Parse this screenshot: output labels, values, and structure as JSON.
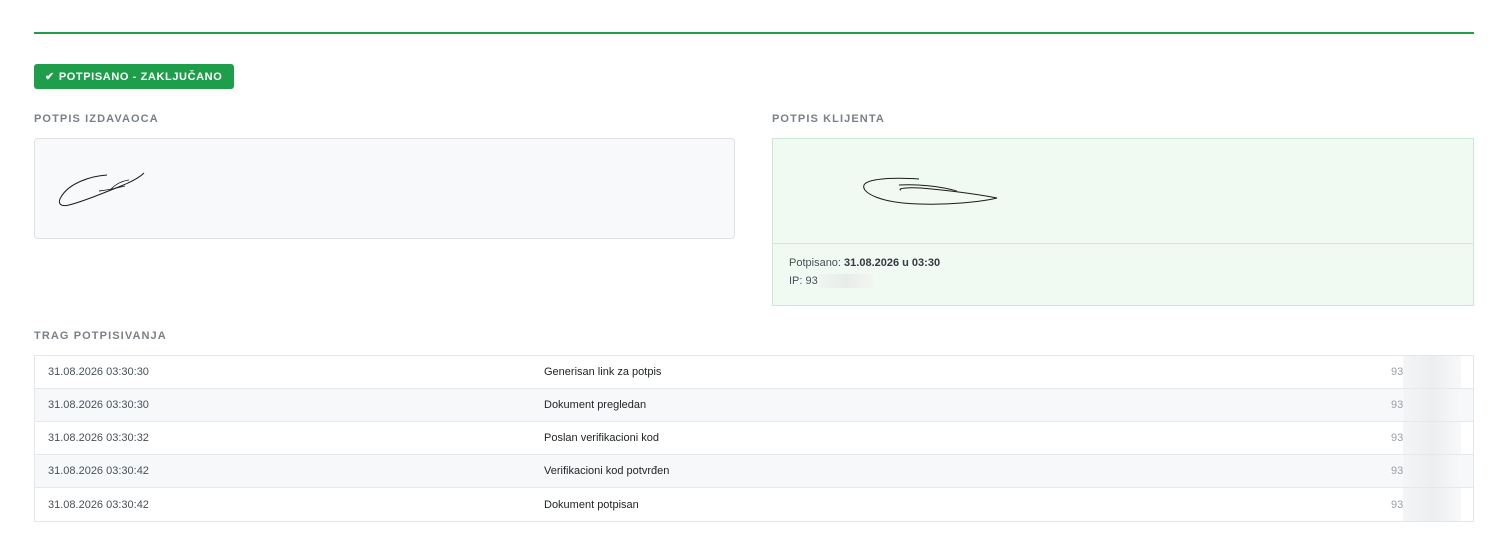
{
  "status": {
    "label": "POTPISANO - ZAKLJUČANO",
    "check_icon": "✔",
    "color": "#1e9e4a"
  },
  "issuer": {
    "heading": "POTPIS IZDAVAOCA"
  },
  "client": {
    "heading": "POTPIS KLIJENTA",
    "signed_label": "Potpisano:",
    "signed_value": "31.08.2026 u 03:30",
    "ip_label": "IP:",
    "ip_visible": "93"
  },
  "trail": {
    "heading": "TRAG POTPISIVANJA",
    "rows": [
      {
        "time": "31.08.2026 03:30:30",
        "event": "Generisan link za potpis",
        "ip": "93"
      },
      {
        "time": "31.08.2026 03:30:30",
        "event": "Dokument pregledan",
        "ip": "93"
      },
      {
        "time": "31.08.2026 03:30:32",
        "event": "Poslan verifikacioni kod",
        "ip": "93"
      },
      {
        "time": "31.08.2026 03:30:42",
        "event": "Verifikacioni kod potvrđen",
        "ip": "93"
      },
      {
        "time": "31.08.2026 03:30:42",
        "event": "Dokument potpisan",
        "ip": "93"
      }
    ]
  }
}
